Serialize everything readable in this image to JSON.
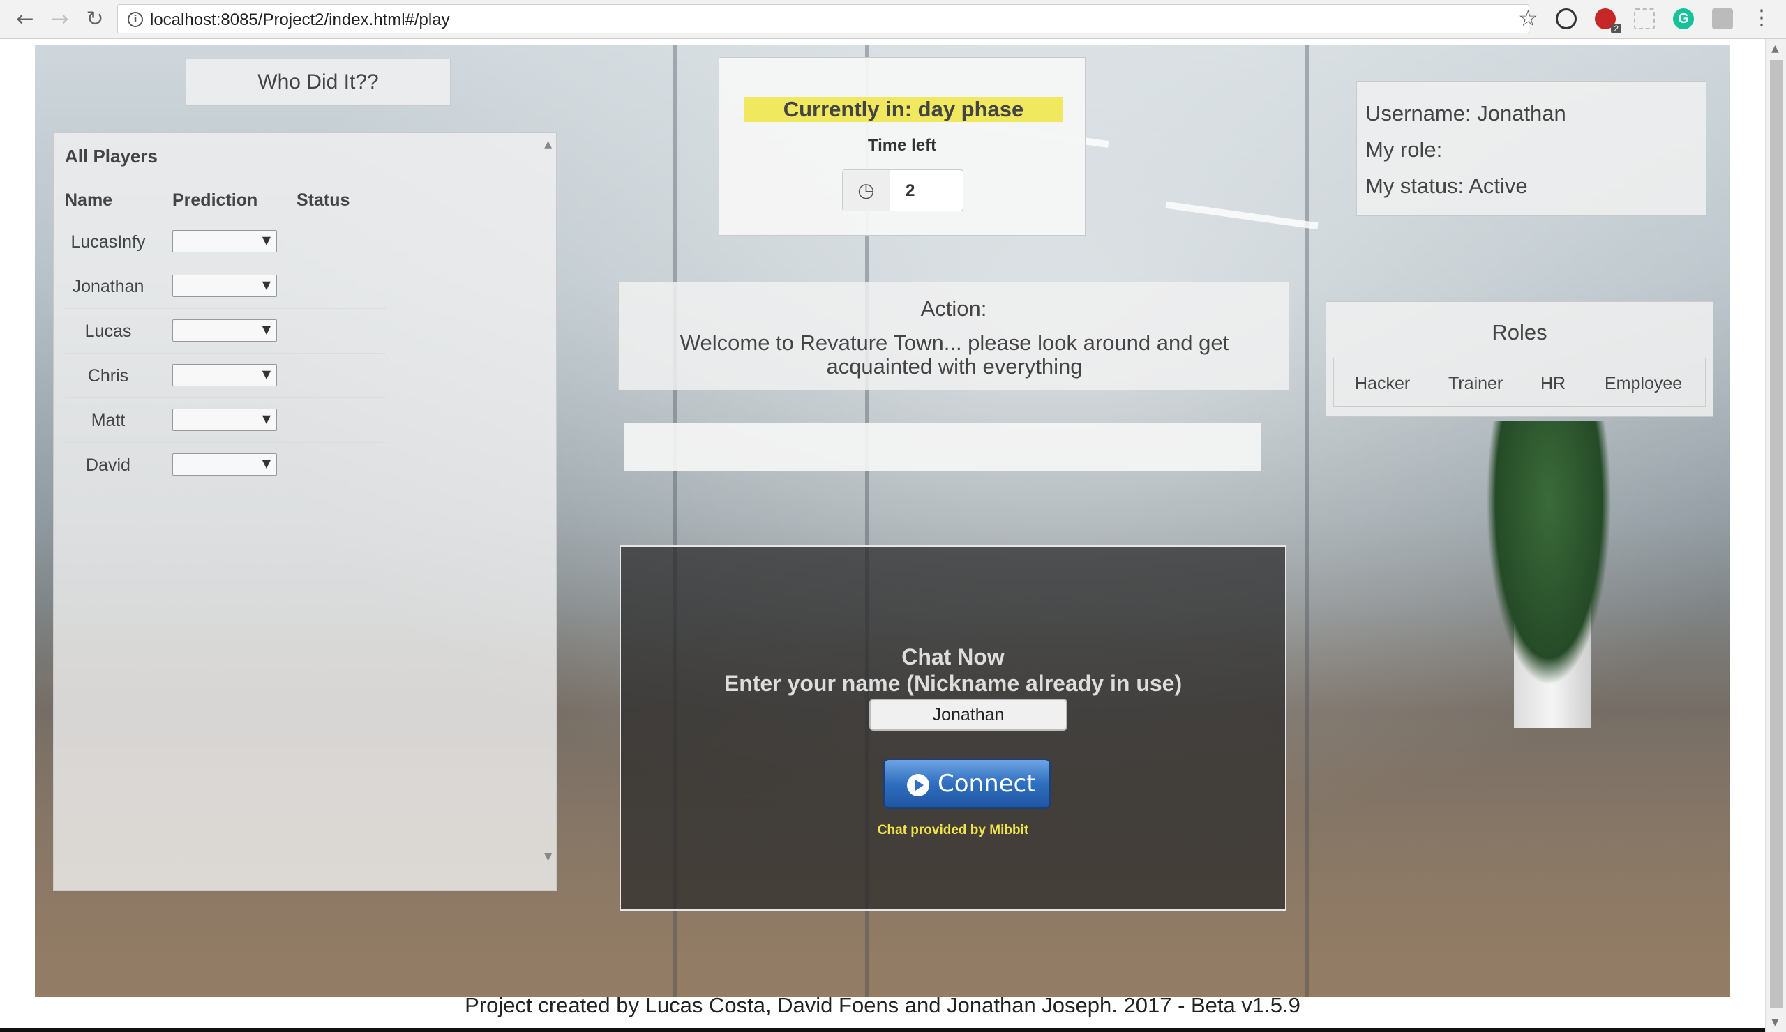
{
  "browser": {
    "url": "localhost:8085/Project2/index.html#/play",
    "extension_badge": "2",
    "grammarly_letter": "G"
  },
  "page": {
    "title": "Who Did It??",
    "players": {
      "heading": "All Players",
      "columns": {
        "name": "Name",
        "prediction": "Prediction",
        "status": "Status"
      },
      "rows": [
        {
          "name": "LucasInfy"
        },
        {
          "name": "Jonathan"
        },
        {
          "name": "Lucas"
        },
        {
          "name": "Chris"
        },
        {
          "name": "Matt"
        },
        {
          "name": "David"
        }
      ]
    },
    "phase": {
      "banner": "Currently in: day phase",
      "time_label": "Time left",
      "time_value": "2"
    },
    "user": {
      "username": "Username: Jonathan",
      "role": "My role:",
      "status": "My status: Active"
    },
    "action": {
      "label": "Action:",
      "message": "Welcome to Revature Town... please look around and get acquainted with everything"
    },
    "roles": {
      "title": "Roles",
      "items": [
        "Hacker",
        "Trainer",
        "HR",
        "Employee"
      ]
    },
    "chat": {
      "title": "Chat Now",
      "prompt": "Enter your name (Nickname already in use)",
      "name_value": "Jonathan",
      "connect_label": "Connect",
      "provider": "Chat provided by Mibbit"
    },
    "footer": "Project created by Lucas Costa, David Foens and Jonathan Joseph. 2017 - Beta v1.5.9"
  },
  "colors": {
    "phase_banner": "#f0e960",
    "provider_text": "#f2e54a",
    "connect_button": "#2f6fbf"
  }
}
